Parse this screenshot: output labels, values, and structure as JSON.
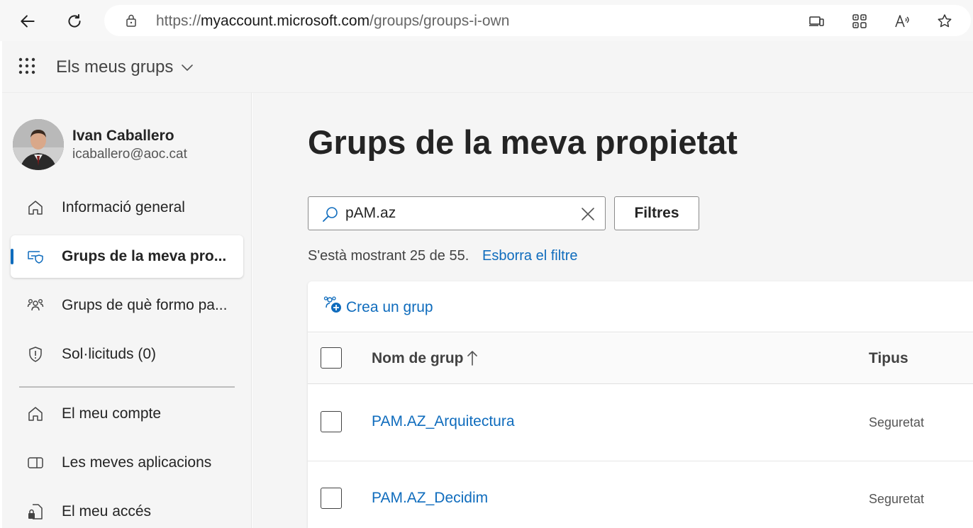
{
  "browser": {
    "url_prefix": "https://",
    "url_host": "myaccount.microsoft.com",
    "url_path": "/groups/groups-i-own"
  },
  "app": {
    "title": "Els meus grups"
  },
  "user": {
    "name": "Ivan Caballero",
    "email": "icaballero@aoc.cat"
  },
  "sidebar": {
    "items": [
      {
        "label": "Informació general",
        "icon": "home-icon"
      },
      {
        "label": "Grups de la meva pro...",
        "icon": "group-shield-icon",
        "active": true
      },
      {
        "label": "Grups de què formo pa...",
        "icon": "people-community-icon"
      },
      {
        "label": "Sol·licituds (0)",
        "icon": "shield-icon"
      },
      {
        "label": "El meu compte",
        "icon": "home-icon"
      },
      {
        "label": "Les meves aplicacions",
        "icon": "apps-icon"
      },
      {
        "label": "El meu accés",
        "icon": "lock-document-icon"
      }
    ]
  },
  "main": {
    "title": "Grups de la meva propietat",
    "search": {
      "value": "pAM.az",
      "placeholder": ""
    },
    "filter_label": "Filtres",
    "result_text": "S'està mostrant 25 de 55.",
    "clear_filter_label": "Esborra el filtre",
    "create_label": "Crea un grup",
    "table": {
      "headers": {
        "name": "Nom de grup",
        "type": "Tipus"
      },
      "rows": [
        {
          "name": "PAM.AZ_Arquitectura",
          "type": "Seguretat"
        },
        {
          "name": "PAM.AZ_Decidim",
          "type": "Seguretat"
        }
      ]
    }
  },
  "colors": {
    "accent": "#0f6cbd",
    "background": "#f5f5f5",
    "text": "#242424"
  }
}
